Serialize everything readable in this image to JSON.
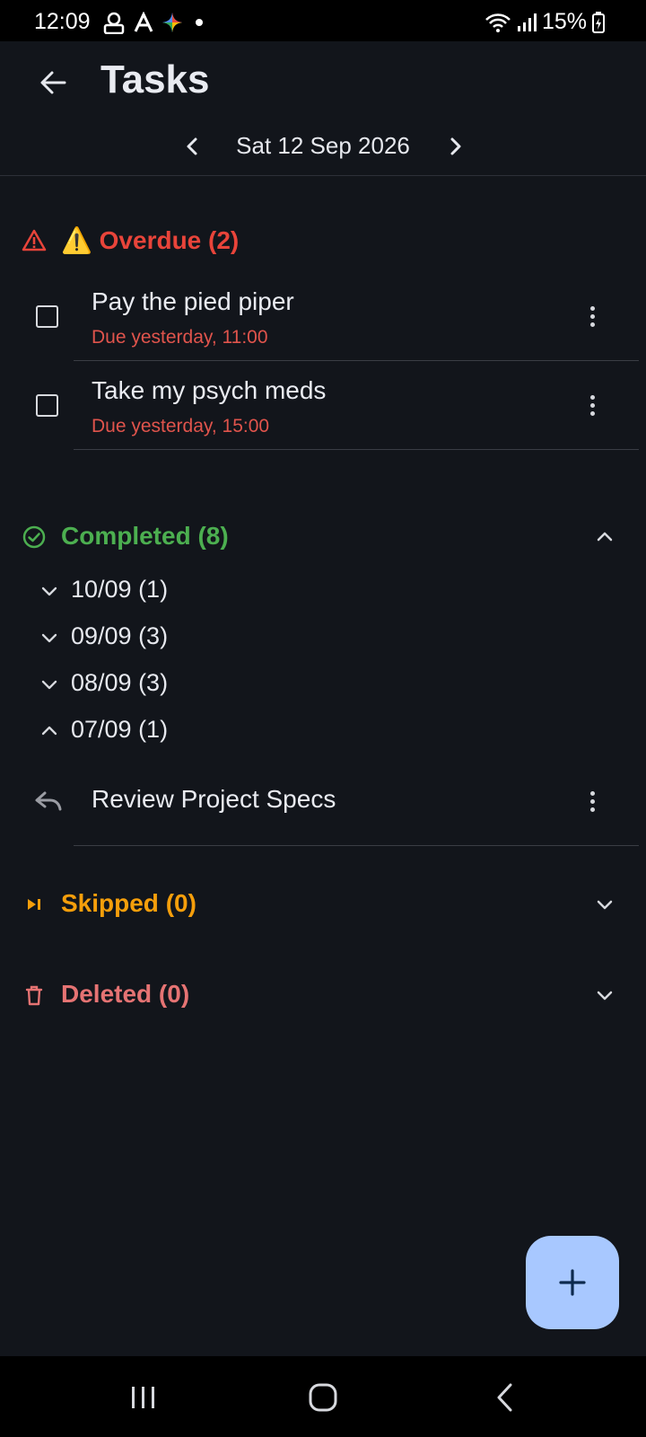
{
  "status_bar": {
    "time": "12:09",
    "battery": "15%",
    "notification_icons": [
      "account-icon",
      "app-a-icon",
      "sparkle-icon",
      "dot-icon"
    ]
  },
  "header": {
    "title": "Tasks",
    "back_icon": "arrow-back-icon"
  },
  "date_nav": {
    "date": "Sat 12 Sep 2026"
  },
  "overdue": {
    "label": "⚠️ Overdue (2)",
    "color": "#e8443a",
    "tasks": [
      {
        "title": "Pay the pied piper",
        "due": "Due yesterday, 11:00"
      },
      {
        "title": "Take my psych meds",
        "due": "Due yesterday, 15:00"
      }
    ]
  },
  "completed": {
    "label": "Completed (8)",
    "color": "#4caf50",
    "expanded": true,
    "groups": [
      {
        "label": "10/09 (1)",
        "expanded": false
      },
      {
        "label": "09/09 (3)",
        "expanded": false
      },
      {
        "label": "08/09 (3)",
        "expanded": false
      },
      {
        "label": "07/09 (1)",
        "expanded": true
      }
    ],
    "tasks": [
      {
        "title": "Review Project Specs"
      }
    ]
  },
  "skipped": {
    "label": "Skipped (0)",
    "color": "#f59e0b",
    "expanded": false
  },
  "deleted": {
    "label": "Deleted (0)",
    "color": "#e57373",
    "expanded": false
  },
  "fab": {
    "icon": "plus-icon",
    "color": "#a8c8ff"
  }
}
